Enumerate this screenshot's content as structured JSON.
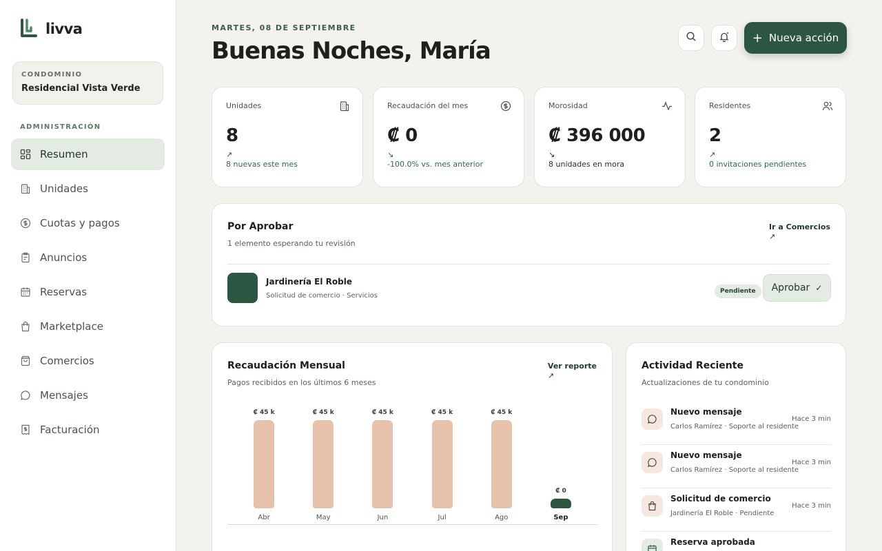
{
  "app": {
    "name": "livva"
  },
  "sidebar": {
    "condo_label": "CONDOMINIO",
    "condo_name": "Residencial Vista Verde",
    "section_label": "ADMINISTRACIÓN",
    "items": [
      {
        "label": "Resumen",
        "icon": "dashboard-icon",
        "active": true
      },
      {
        "label": "Unidades",
        "icon": "building-icon"
      },
      {
        "label": "Cuotas y pagos",
        "icon": "dollar-circle-icon"
      },
      {
        "label": "Anuncios",
        "icon": "clipboard-icon"
      },
      {
        "label": "Reservas",
        "icon": "calendar-icon"
      },
      {
        "label": "Marketplace",
        "icon": "shopping-bag-icon"
      },
      {
        "label": "Comercios",
        "icon": "store-bag-icon"
      },
      {
        "label": "Mensajes",
        "icon": "chat-icon"
      },
      {
        "label": "Facturación",
        "icon": "invoice-icon"
      }
    ]
  },
  "header": {
    "date": "MARTES, 08 DE SEPTIEMBRE",
    "greeting": "Buenas Noches, María",
    "new_action_label": "Nueva acción",
    "new_action_icon": "+"
  },
  "stats": [
    {
      "label": "Unidades",
      "value": "8",
      "arrow": "↗",
      "note": "8 nuevas este mes",
      "icon": "building-icon"
    },
    {
      "label": "Recaudación del mes",
      "value": "₡ 0",
      "arrow": "↘",
      "note": "-100.0% vs. mes anterior",
      "icon": "dollar-circle-icon"
    },
    {
      "label": "Morosidad",
      "value": "₡ 396 000",
      "arrow": "↘",
      "note": "8 unidades en mora",
      "icon": "activity-icon"
    },
    {
      "label": "Residentes",
      "value": "2",
      "arrow": "↗",
      "note": "0 invitaciones pendientes",
      "icon": "users-icon"
    }
  ],
  "pending": {
    "title": "Por Aprobar",
    "subtitle": "1 elemento esperando tu revisión",
    "link_label": "Ir a Comercios",
    "link_arrow": "↗",
    "item": {
      "name": "Jardinería El Roble",
      "detail": "Solicitud de comercio · Servicios",
      "status": "Pendiente",
      "approve_label": "Aprobar",
      "approve_icon": "✓"
    }
  },
  "revenue": {
    "title": "Recaudación Mensual",
    "subtitle": "Pagos recibidos en los últimos 6 meses",
    "link_label": "Ver reporte",
    "link_arrow": "↗"
  },
  "chart_data": {
    "type": "bar",
    "categories": [
      "Abr",
      "May",
      "Jun",
      "Jul",
      "Ago",
      "Sep"
    ],
    "values": [
      45000,
      45000,
      45000,
      45000,
      45000,
      0
    ],
    "data_labels": [
      "₡ 45 k",
      "₡ 45 k",
      "₡ 45 k",
      "₡ 45 k",
      "₡ 45 k",
      "₡ 0"
    ],
    "highlight_category": "Sep",
    "colors": {
      "past": "#e7c2ab",
      "current": "#2c5641"
    },
    "grid": false,
    "ylim": [
      0,
      45000
    ]
  },
  "activity": {
    "title": "Actividad Reciente",
    "subtitle": "Actualizaciones de tu condominio",
    "items": [
      {
        "title": "Nuevo mensaje",
        "detail": "Carlos Ramírez · Soporte al residente",
        "time": "Hace 3 min",
        "icon": "chat-icon"
      },
      {
        "title": "Nuevo mensaje",
        "detail": "Carlos Ramírez · Soporte al residente",
        "time": "Hace 3 min",
        "icon": "chat-icon"
      },
      {
        "title": "Solicitud de comercio",
        "detail": "Jardinería El Roble · Pendiente",
        "time": "Hace 3 min",
        "icon": "shopping-bag-icon"
      },
      {
        "title": "Reserva aprobada",
        "detail": "",
        "time": "",
        "icon": "calendar-icon"
      }
    ]
  },
  "colors": {
    "brand": "#2c5641",
    "accent_soft": "#e3ebe3",
    "bar": "#e7c2ab",
    "background": "#f4f2ee"
  }
}
